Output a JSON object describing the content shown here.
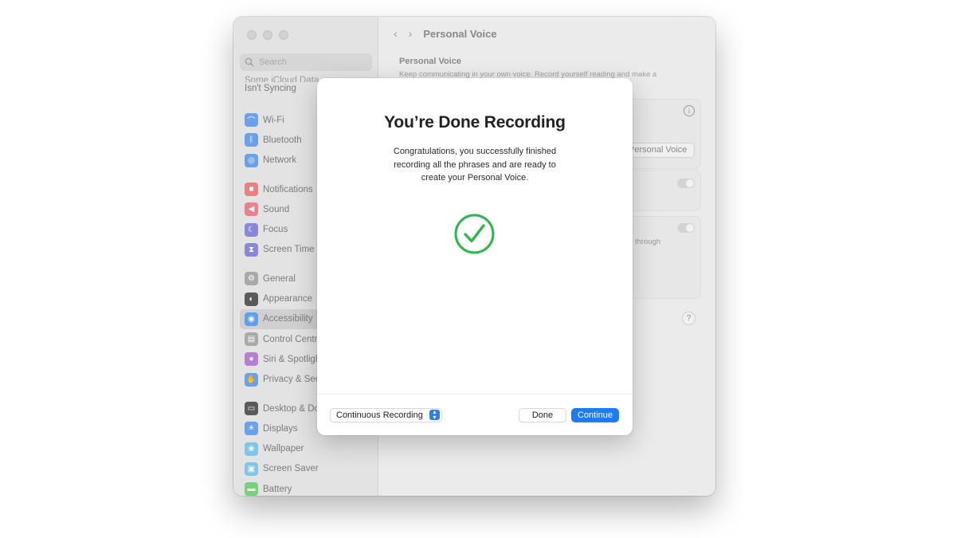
{
  "window": {
    "nav_title": "Personal Voice",
    "search_placeholder": "Search",
    "icloud_line1": "Some iCloud Data",
    "icloud_line2": "Isn't Syncing"
  },
  "sidebar": {
    "groups": [
      [
        {
          "label": "Wi-Fi",
          "icon": "wifi-icon",
          "color": "#6aa0ec"
        },
        {
          "label": "Bluetooth",
          "icon": "bluetooth-icon",
          "color": "#6aa0ec"
        },
        {
          "label": "Network",
          "icon": "globe-icon",
          "color": "#6aa0ec"
        }
      ],
      [
        {
          "label": "Notifications",
          "icon": "bell-icon",
          "color": "#ea8080"
        },
        {
          "label": "Sound",
          "icon": "speaker-icon",
          "color": "#ea7f8e"
        },
        {
          "label": "Focus",
          "icon": "moon-icon",
          "color": "#8b86d8"
        },
        {
          "label": "Screen Time",
          "icon": "hourglass-icon",
          "color": "#8b86d8"
        }
      ],
      [
        {
          "label": "General",
          "icon": "gear-icon",
          "color": "#a9a9a9"
        },
        {
          "label": "Appearance",
          "icon": "appearance-icon",
          "color": "#5a5a5a"
        },
        {
          "label": "Accessibility",
          "icon": "accessibility-icon",
          "color": "#5fa0ea",
          "selected": true
        },
        {
          "label": "Control Centre",
          "icon": "control-centre-icon",
          "color": "#a9a9a9"
        },
        {
          "label": "Siri & Spotlight",
          "icon": "siri-icon",
          "color": "#b77fd0"
        },
        {
          "label": "Privacy & Security",
          "icon": "hand-icon",
          "color": "#6aa0ec"
        }
      ],
      [
        {
          "label": "Desktop & Dock",
          "icon": "dock-icon",
          "color": "#5a5a5a"
        },
        {
          "label": "Displays",
          "icon": "sun-icon",
          "color": "#6aa0ec"
        },
        {
          "label": "Wallpaper",
          "icon": "wallpaper-icon",
          "color": "#7fc6e8"
        },
        {
          "label": "Screen Saver",
          "icon": "screensaver-icon",
          "color": "#7fc6e8"
        },
        {
          "label": "Battery",
          "icon": "battery-icon",
          "color": "#7bd17b"
        }
      ]
    ]
  },
  "main": {
    "section_title": "Personal Voice",
    "section_desc": "Keep communicating in your own voice. Record yourself reading and make a",
    "personal_voice_button": "Personal Voice",
    "through_text": "through"
  },
  "dialog": {
    "title": "You’re Done Recording",
    "description": "Congratulations, you successfully finished recording all the phrases and are ready to create your Personal Voice.",
    "mode_select": "Continuous Recording",
    "done_label": "Done",
    "continue_label": "Continue",
    "check_color": "#29b84a",
    "accent": "#1e7cf2"
  }
}
